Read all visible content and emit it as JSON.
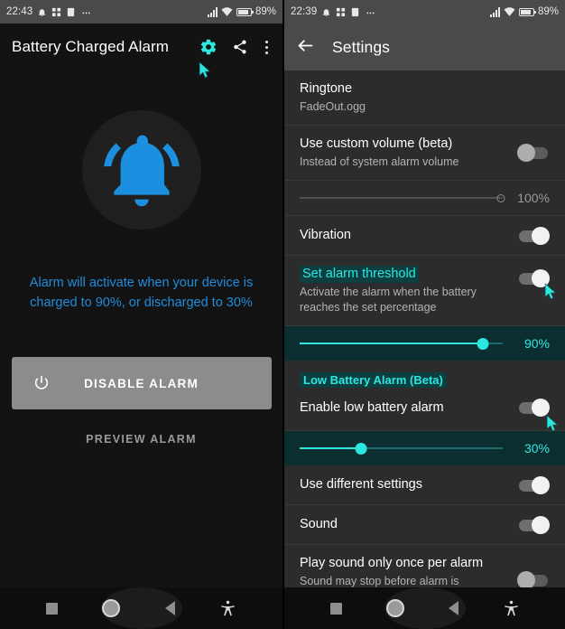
{
  "left": {
    "statusbar": {
      "time": "22:43",
      "battery_pct": "89%",
      "icons": [
        "alarm-bell-icon",
        "apps-icon",
        "app-icon",
        "more-notifications-icon",
        "signal-icon",
        "wifi-icon",
        "battery-icon"
      ]
    },
    "appbar": {
      "title": "Battery Charged Alarm",
      "settings_icon": "gear-icon",
      "share_icon": "share-icon",
      "overflow_icon": "overflow-menu-icon"
    },
    "main": {
      "bell_icon": "ringing-bell-icon",
      "alarm_note": "Alarm will activate when your device is charged to 90%, or discharged to 30%",
      "disable_button": "DISABLE ALARM",
      "power_icon": "power-icon",
      "preview_button": "PREVIEW ALARM"
    }
  },
  "right": {
    "statusbar": {
      "time": "22:39",
      "battery_pct": "89%"
    },
    "appbar": {
      "back_icon": "back-arrow-icon",
      "title": "Settings"
    },
    "settings": [
      {
        "id": "ringtone",
        "title": "Ringtone",
        "subtitle": "FadeOut.ogg",
        "control": "none",
        "highlight": false
      },
      {
        "id": "use-custom-volume",
        "title": "Use custom volume (beta)",
        "subtitle": "Instead of system alarm volume",
        "control": "toggle",
        "toggle_state": "off",
        "highlight": false
      },
      {
        "id": "volume-slider",
        "control": "slider",
        "value": "100%",
        "percent": 100,
        "style": "volume",
        "highlight": false
      },
      {
        "id": "vibration",
        "title": "Vibration",
        "subtitle": "",
        "control": "toggle",
        "toggle_state": "on",
        "highlight": false
      },
      {
        "id": "set-alarm-threshold",
        "title": "Set alarm threshold",
        "subtitle": "Activate the alarm when the battery reaches the set percentage",
        "control": "toggle",
        "toggle_state": "on",
        "highlight": true
      },
      {
        "id": "threshold-slider",
        "control": "slider",
        "value": "90%",
        "percent": 90,
        "style": "teal",
        "highlight": true
      },
      {
        "id": "low-battery-section",
        "section_header": "Low Battery Alarm (Beta)",
        "control": "header"
      },
      {
        "id": "enable-low-battery-alarm",
        "title": "Enable low battery alarm",
        "subtitle": "",
        "control": "toggle",
        "toggle_state": "on",
        "highlight": false
      },
      {
        "id": "low-battery-slider",
        "control": "slider",
        "value": "30%",
        "percent": 30,
        "style": "teal",
        "highlight": true
      },
      {
        "id": "use-different-settings",
        "title": "Use different settings",
        "subtitle": "",
        "control": "toggle",
        "toggle_state": "on",
        "highlight": false
      },
      {
        "id": "sound",
        "title": "Sound",
        "subtitle": "",
        "control": "toggle",
        "toggle_state": "on",
        "highlight": false
      },
      {
        "id": "play-sound-once",
        "title": "Play sound only once per alarm",
        "subtitle": "Sound may stop before alarm is dismissed/ device is plugged",
        "control": "toggle",
        "toggle_state": "off",
        "highlight": false
      }
    ]
  },
  "navbar": {
    "recents": "recents-square-icon",
    "home": "home-circle-icon",
    "back": "back-triangle-icon",
    "accessibility": "accessibility-icon"
  },
  "colors": {
    "accent_teal": "#2ee6e0",
    "accent_blue": "#1f8ddb",
    "highlight_bg": "#0d3f40",
    "surface": "#2c2c2c",
    "appbar_right": "#4a4a4a",
    "cursor": "#2ee6e0"
  }
}
